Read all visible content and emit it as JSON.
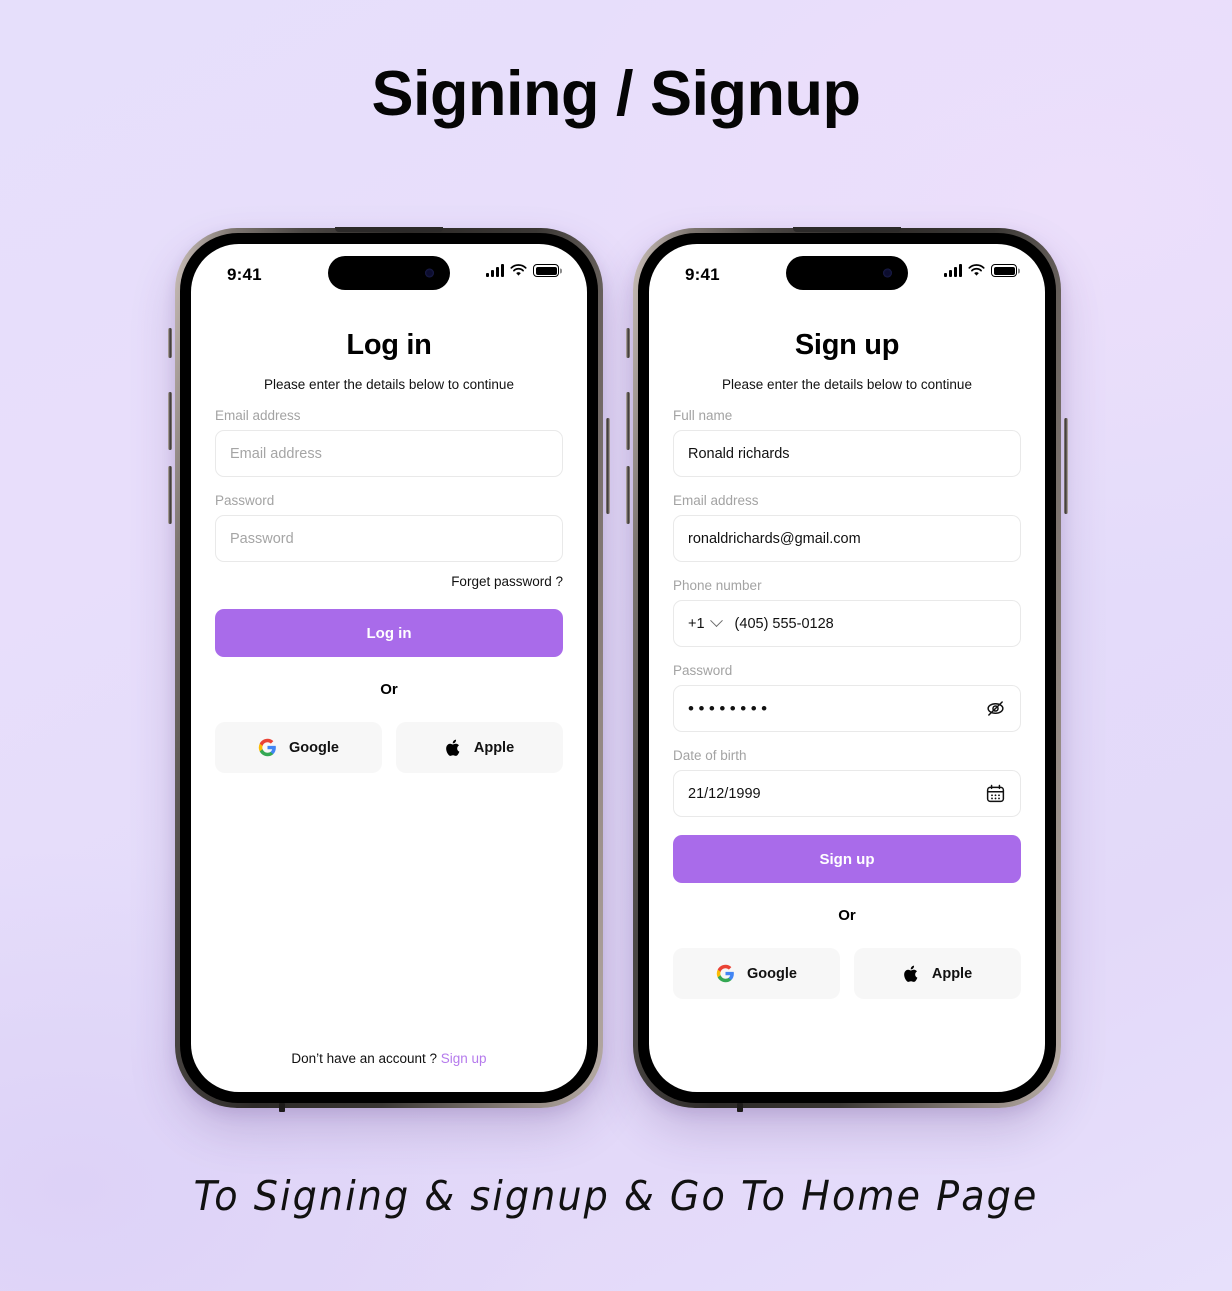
{
  "page": {
    "title": "Signing / Signup",
    "caption": "To Signing & signup & Go To Home Page",
    "accent_color": "#a96bea",
    "link_color": "#b57aec",
    "background_color": "#e6dffb"
  },
  "status_bar": {
    "time": "9:41",
    "icons": [
      "cellular-signal-icon",
      "wifi-icon",
      "battery-icon"
    ]
  },
  "login": {
    "title": "Log in",
    "subtitle": "Please enter the details below to continue",
    "fields": [
      {
        "label": "Email address",
        "placeholder": "Email address",
        "value": ""
      },
      {
        "label": "Password",
        "placeholder": "Password",
        "value": ""
      }
    ],
    "forgot_password": "Forget password ?",
    "cta_label": "Log in",
    "or_label": "Or",
    "social": [
      {
        "label": "Google",
        "icon": "google-icon"
      },
      {
        "label": "Apple",
        "icon": "apple-icon"
      }
    ],
    "footer_text": "Don’t have an account ?",
    "footer_link": "Sign up"
  },
  "signup": {
    "title": "Sign up",
    "subtitle": "Please enter the details below to continue",
    "fields": [
      {
        "label": "Full name",
        "value": "Ronald richards"
      },
      {
        "label": "Email address",
        "value": "ronaldrichards@gmail.com"
      },
      {
        "label": "Phone number",
        "dial_code": "+1",
        "value": "(405) 555-0128"
      },
      {
        "label": "Password",
        "value": "••••••••",
        "trailing_icon": "eye-off-icon"
      },
      {
        "label": "Date of birth",
        "value": "21/12/1999",
        "trailing_icon": "calendar-icon"
      }
    ],
    "cta_label": "Sign up",
    "or_label": "Or",
    "social": [
      {
        "label": "Google",
        "icon": "google-icon"
      },
      {
        "label": "Apple",
        "icon": "apple-icon"
      }
    ]
  }
}
